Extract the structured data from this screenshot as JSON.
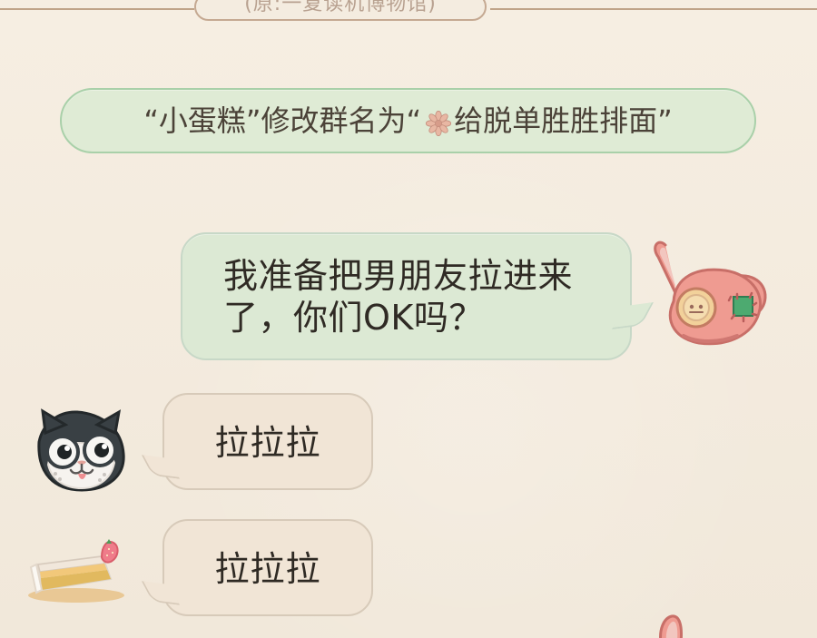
{
  "header": {
    "label": "(原:一复读机博物馆)"
  },
  "system": {
    "text_before": "“小蛋糕”修改群名为“",
    "text_after": "给脱单胜胜排面”"
  },
  "messages": [
    {
      "sender": "right",
      "text": "我准备把男朋友拉进来了，你们OK吗？"
    },
    {
      "sender": "left",
      "text": "拉拉拉"
    },
    {
      "sender": "left",
      "text": "拉拉拉"
    }
  ],
  "icons": {
    "flower": "flower-icon",
    "rabbit_avatar": "pink-rabbit-avatar",
    "cat_avatar": "black-white-cat-avatar",
    "cake_avatar": "strawberry-cake-avatar",
    "peek_avatar": "pink-rabbit-ear-avatar"
  },
  "colors": {
    "background": "#f4ece0",
    "system_pill": "#dfebd5",
    "right_bubble": "#dce9d4",
    "left_bubble": "#f1e5d6"
  }
}
